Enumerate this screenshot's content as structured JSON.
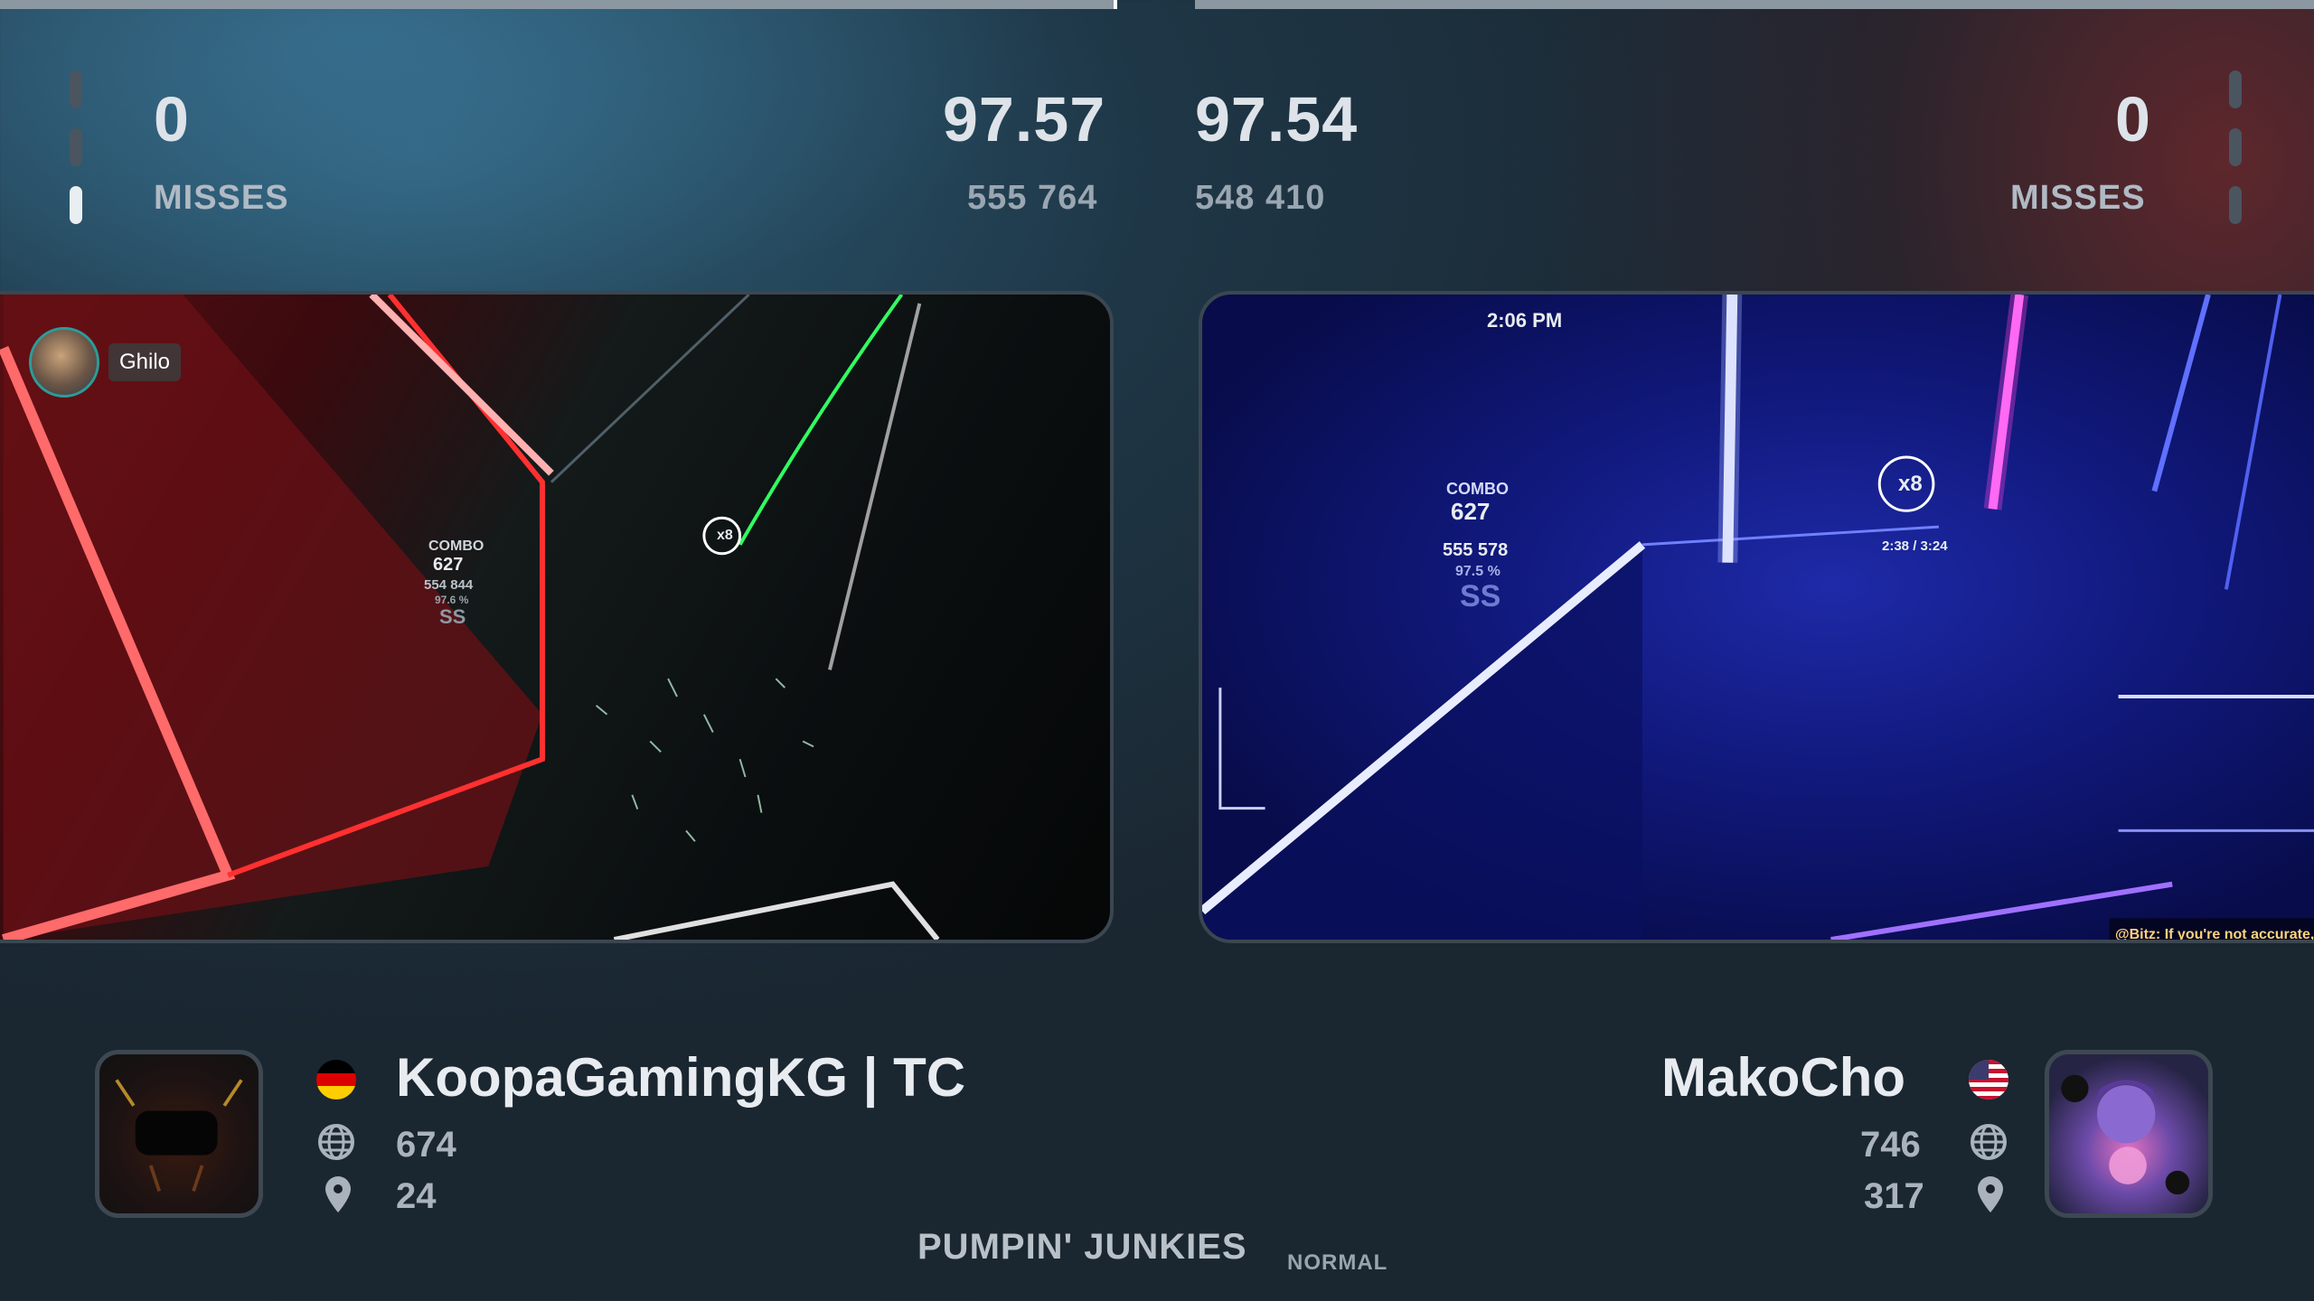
{
  "left_player": {
    "misses": "0",
    "misses_label": "MISSES",
    "accuracy": "97.57",
    "score": "555 764",
    "name": "KoopaGamingKG | TC",
    "country": "Germany",
    "global_rank": "674",
    "local_rank": "24",
    "streamer_name": "Ghilo"
  },
  "right_player": {
    "misses": "0",
    "misses_label": "MISSES",
    "accuracy": "97.54",
    "score": "548 410",
    "name": "MakoCho",
    "country": "United States",
    "global_rank": "746",
    "local_rank": "317"
  },
  "song": {
    "title": "PUMPIN' JUNKIES",
    "difficulty": "NORMAL"
  },
  "left_hud": {
    "combo_label": "COMBO",
    "combo": "627",
    "score": "554 844",
    "percent": "97.6 %",
    "rank": "SS",
    "multiplier": "x8"
  },
  "right_hud": {
    "clock": "2:06 PM",
    "combo_label": "COMBO",
    "combo": "627",
    "score": "555 578",
    "percent": "97.5 %",
    "rank": "SS",
    "multiplier": "x8",
    "time": "2:38 / 3:24",
    "chat_last": "@Bitz: If you're not accurate, you're l"
  },
  "colors": {
    "accent_white": "#e8ecf0",
    "stat_gray": "#aab3bc",
    "left_saber": "#ff2a2a",
    "right_saber": "#3040ff"
  },
  "icons": [
    "globe-icon",
    "location-pin-icon",
    "flag-de-icon",
    "flag-us-icon"
  ]
}
